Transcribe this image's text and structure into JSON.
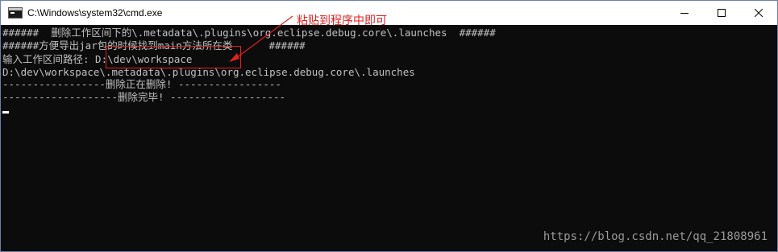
{
  "window": {
    "title": "C:\\Windows\\system32\\cmd.exe",
    "icon": "cmd-console-icon",
    "controls": [
      "minimize-icon",
      "maximize-icon",
      "close-icon"
    ]
  },
  "console": {
    "lines": [
      "######  删除工作区间下的\\.metadata\\.plugins\\org.eclipse.debug.core\\.launches  ######",
      "######方便导出jar包的时候找到main方法所在类      ######",
      "输入工作区间路径: D:\\dev\\workspace",
      "D:\\dev\\workspace\\.metadata\\.plugins\\org.eclipse.debug.core\\.launches",
      "-----------------删除正在删除! -----------------",
      "-------------------删除完毕! -------------------"
    ]
  },
  "annotation": {
    "text": "粘贴到程序中即可",
    "color": "#e02020"
  },
  "watermark": {
    "text": "https://blog.csdn.net/qq_21808961"
  }
}
